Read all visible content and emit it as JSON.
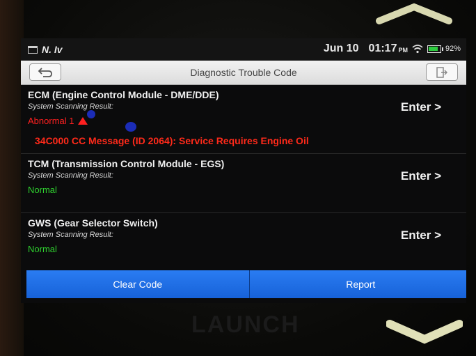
{
  "status_bar": {
    "app_icons": "N. Iv",
    "date": "Jun 10",
    "time": "01:17",
    "ampm": "PM",
    "battery": "92%"
  },
  "title_bar": {
    "title": "Diagnostic Trouble Code"
  },
  "modules": [
    {
      "name": "ECM (Engine Control Module - DME/DDE)",
      "scan_label": "System Scanning Result:",
      "status": "Abnormal 1",
      "status_type": "abnormal",
      "enter_label": "Enter >",
      "dtc": "34C000 CC Message (ID 2064): Service Requires Engine Oil"
    },
    {
      "name": "TCM (Transmission Control Module - EGS)",
      "scan_label": "System Scanning Result:",
      "status": "Normal",
      "status_type": "normal",
      "enter_label": "Enter >"
    },
    {
      "name": "GWS (Gear Selector Switch)",
      "scan_label": "System Scanning Result:",
      "status": "Normal",
      "status_type": "normal",
      "enter_label": "Enter >"
    }
  ],
  "bottom_bar": {
    "clear_code": "Clear Code",
    "report": "Report"
  },
  "device_logo": "LAUNCH",
  "colors": {
    "abnormal": "#ff2020",
    "normal": "#2fd12f",
    "button_blue": "#1e6fe6"
  }
}
